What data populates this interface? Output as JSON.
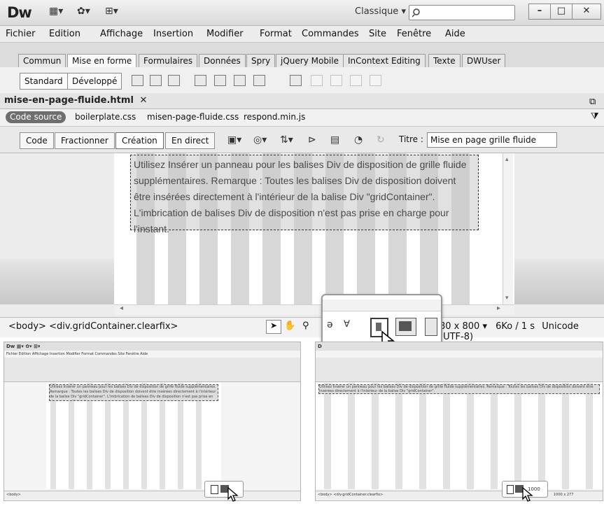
{
  "app": {
    "logo": "Dw",
    "workspace": "Classique",
    "workspace_arrow": "▾"
  },
  "window_buttons": [
    "–",
    "□",
    "✕"
  ],
  "menu": [
    "Fichier",
    "Edition",
    "Affichage",
    "Insertion",
    "Modifier",
    "Format",
    "Commandes",
    "Site",
    "Fenêtre",
    "Aide"
  ],
  "insert_tabs": [
    "Commun",
    "Mise en forme",
    "Formulaires",
    "Données",
    "Spry",
    "jQuery Mobile",
    "InContext Editing",
    "Texte",
    "DWUser"
  ],
  "insert_toolbar": {
    "standard": "Standard",
    "developpe": "Développé"
  },
  "document": {
    "tab_name": "mise-en-page-fluide.html",
    "close": "✕",
    "code_source": "Code source",
    "related_files": [
      "boilerplate.css",
      "misen-page-fluide.css",
      "respond.min.js"
    ]
  },
  "doc_toolbar": {
    "views": [
      "Code",
      "Fractionner",
      "Création",
      "En direct"
    ],
    "title_label": "Titre :",
    "title_value": "Mise en page grille fluide"
  },
  "placeholder_text": "Utilisez Insérer un panneau pour les balises Div de disposition de grille fluide supplémentaires. Remarque : Toutes les balises Div de disposition doivent être insérées directement à l'intérieur de la balise Div \"gridContainer\". L'imbrication de balises Div de disposition n'est pas prise en charge pour l'instant.",
  "status": {
    "tag_selector": "<body> <div.gridContainer.clearfix>",
    "size": "80 x 800 ▾",
    "download": "6Ko / 1 s",
    "encoding": "Unicode (UTF-8)"
  },
  "thumb1": {
    "menu": "Fichier   Edition   Affichage   Insertion   Modifier   Format   Commandes   Site   Fenêtre   Aide",
    "text": "Utilisez Insérer un panneau pour les balises Div de disposition de grille fluide supplémentaires. Remarque : Toutes les balises Div de disposition doivent être insérées directement à l'intérieur de la balise Div \"gridContainer\". L'imbrication de balises Div de disposition n'est pas prise en charge pour l'instant.",
    "status": "<body>"
  },
  "thumb2": {
    "text": "Utilisez Insérer un panneau pour les balises Div de disposition de grille fluide supplémentaires. Remarque : Toutes les balises Div de disposition doivent être insérées directement à l'intérieur de la balise Div \"gridContainer\".",
    "status": "<body> <div.gridContainer.clearfix>",
    "size": "1000",
    "size2": "1000 x 277"
  }
}
